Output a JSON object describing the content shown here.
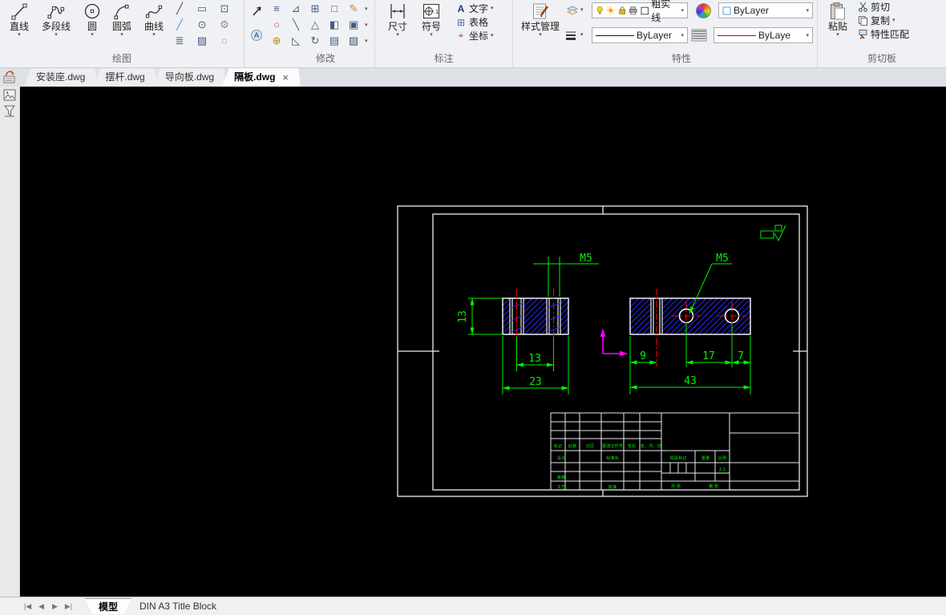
{
  "ribbon": {
    "draw": {
      "label": "绘图",
      "line": "直线",
      "polyline": "多段线",
      "circle": "圆",
      "arc": "圆弧",
      "curve": "曲线",
      "extra_icons": [
        "╱",
        "▭",
        "⊡",
        "╱",
        "⊙",
        "⚙",
        "≣",
        "▨",
        "◌"
      ]
    },
    "modify": {
      "label": "修改",
      "icons": [
        "≡",
        "⊿",
        "⊞",
        "□",
        "✎",
        "○",
        "╲",
        "△",
        "◧",
        "▣",
        "⊕",
        "◺",
        "↻",
        "▤",
        "▨"
      ]
    },
    "annotate": {
      "label": "标注",
      "dimension": "尺寸",
      "symbol": "符号",
      "text": "文字",
      "table": "表格",
      "coordinate": "坐标",
      "text_icon": "A",
      "table_icon": "⊞",
      "coord_icon": "⌖"
    },
    "style_manager": "样式管理",
    "properties": {
      "label": "特性",
      "layer_name": "粗实线",
      "color_value": "ByLayer",
      "linetype_value": "ByLayer",
      "linetype2_value": "ByLayer"
    },
    "clipboard": {
      "label": "剪切板",
      "paste": "粘贴",
      "cut": "剪切",
      "copy": "复制",
      "match_properties": "特性匹配"
    }
  },
  "icons": {
    "caret": "▾",
    "close": "×",
    "nav_first": "|◀",
    "nav_prev": "◀",
    "nav_next": "▶",
    "nav_last": "▶|"
  },
  "doc_tabs": {
    "tabs": [
      "安装座.dwg",
      "摆杆.dwg",
      "导向板.dwg",
      "隔板.dwg"
    ],
    "active_index": 3
  },
  "drawing": {
    "thread_label_left": "M5",
    "thread_label_right": "M5",
    "dims": {
      "left_height": "13",
      "left_hole_spacing": "13",
      "left_width": "23",
      "right_offset": "9",
      "right_spacing": "17",
      "right_edge": "7",
      "right_width": "43"
    },
    "title_block": {
      "rev_headers": [
        "标记",
        "处数",
        "分区",
        "更改文件号",
        "签名",
        "年、月、日"
      ],
      "design": "设计",
      "standardize": "标准化",
      "audit": "审核",
      "process": "工艺",
      "approve": "批准",
      "stage_mark": "阶段标记",
      "weight": "重量",
      "scale_label": "比例",
      "scale_value": "2:1",
      "total_sheets": "共  张",
      "sheet_number": "第  张"
    },
    "colors": {
      "outline": "#ffffff",
      "dimension": "#00f000",
      "hatch": "#2323ff",
      "centerline": "#ff0000",
      "ucs_axis": "#ff00ff",
      "background": "#000000"
    }
  },
  "status_bar": {
    "model_tab": "模型",
    "layout_tab": "DIN A3 Title Block"
  }
}
